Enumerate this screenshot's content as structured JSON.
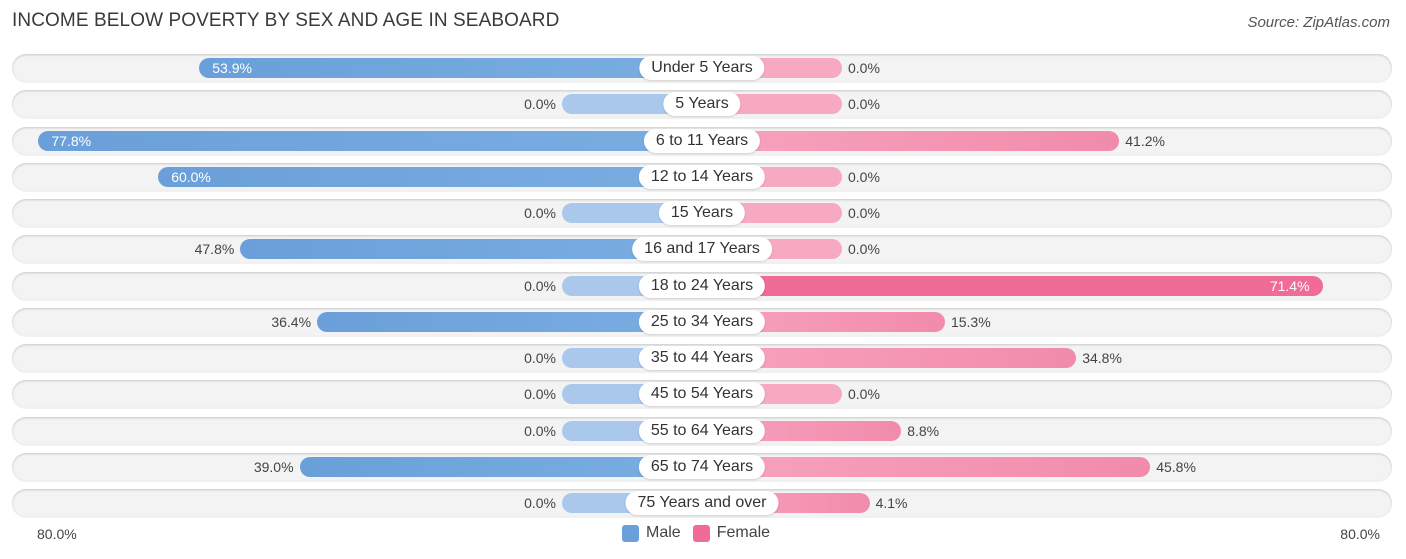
{
  "title": "INCOME BELOW POVERTY BY SEX AND AGE IN SEABOARD",
  "source": "Source: ZipAtlas.com",
  "colors": {
    "male": "#6a9fd9",
    "female": "#f06b95"
  },
  "legend": {
    "male": "Male",
    "female": "Female"
  },
  "axis": {
    "left_label": "80.0%",
    "right_label": "80.0%"
  },
  "chart_data": {
    "type": "bar",
    "orientation": "horizontal-diverging",
    "title": "INCOME BELOW POVERTY BY SEX AND AGE IN SEABOARD",
    "xlim": [
      0,
      80
    ],
    "unit": "%",
    "legend_position": "bottom-center",
    "categories": [
      "Under 5 Years",
      "5 Years",
      "6 to 11 Years",
      "12 to 14 Years",
      "15 Years",
      "16 and 17 Years",
      "18 to 24 Years",
      "25 to 34 Years",
      "35 to 44 Years",
      "45 to 54 Years",
      "55 to 64 Years",
      "65 to 74 Years",
      "75 Years and over"
    ],
    "series": [
      {
        "name": "Male",
        "values": [
          53.9,
          0.0,
          77.8,
          60.0,
          0.0,
          47.8,
          0.0,
          36.4,
          0.0,
          0.0,
          0.0,
          39.0,
          0.0
        ],
        "labels": [
          "53.9%",
          "0.0%",
          "77.8%",
          "60.0%",
          "0.0%",
          "47.8%",
          "0.0%",
          "36.4%",
          "0.0%",
          "0.0%",
          "0.0%",
          "39.0%",
          "0.0%"
        ]
      },
      {
        "name": "Female",
        "values": [
          0.0,
          0.0,
          41.2,
          0.0,
          0.0,
          0.0,
          71.4,
          15.3,
          34.8,
          0.0,
          8.8,
          45.8,
          4.1
        ],
        "labels": [
          "0.0%",
          "0.0%",
          "41.2%",
          "0.0%",
          "0.0%",
          "0.0%",
          "71.4%",
          "15.3%",
          "34.8%",
          "0.0%",
          "8.8%",
          "45.8%",
          "4.1%"
        ]
      }
    ]
  }
}
